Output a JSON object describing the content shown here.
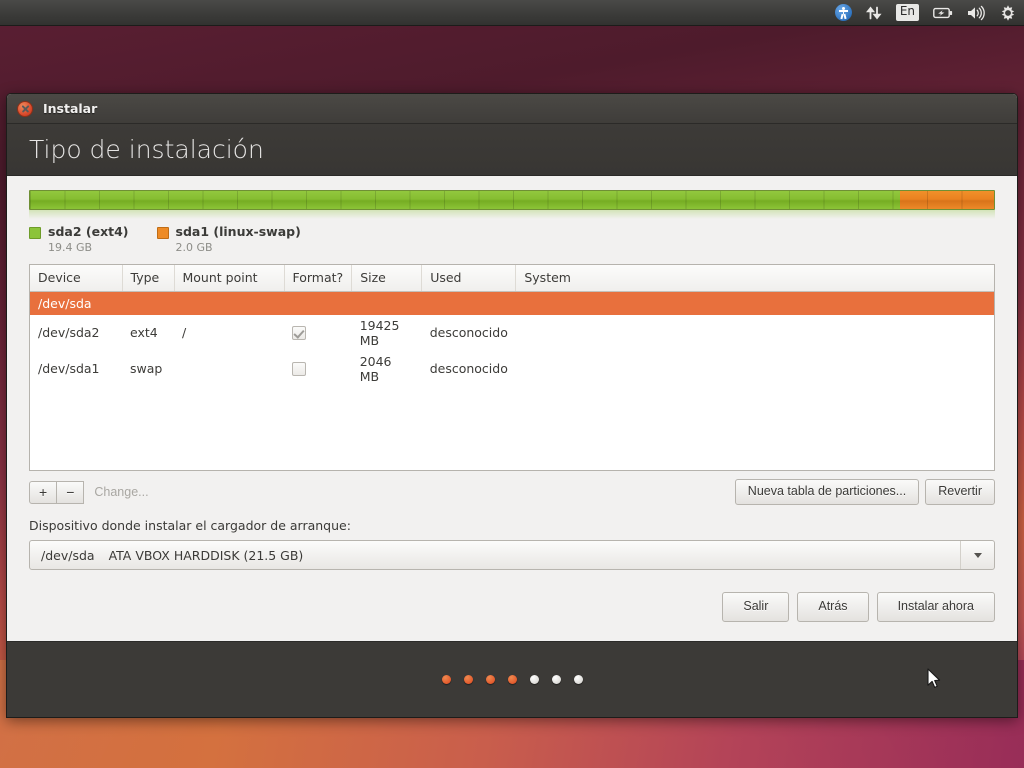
{
  "panel": {
    "icons": [
      {
        "name": "accessibility-icon",
        "label": ""
      },
      {
        "name": "network-icon",
        "label": ""
      },
      {
        "name": "keyboard-layout-indicator",
        "label": "En"
      },
      {
        "name": "battery-icon",
        "label": ""
      },
      {
        "name": "volume-icon",
        "label": ""
      },
      {
        "name": "system-settings-icon",
        "label": ""
      }
    ],
    "keyboard_layout": "En"
  },
  "window": {
    "title": "Instalar",
    "heading": "Tipo de instalación"
  },
  "partition_bar": {
    "segments": [
      {
        "label": "sda2 (ext4)",
        "size": "19.4 GB",
        "color": "#8cc43a",
        "percent": 90.2
      },
      {
        "label": "sda1 (linux-swap)",
        "size": "2.0 GB",
        "color": "#ee8b26",
        "percent": 9.8
      }
    ]
  },
  "table": {
    "columns": [
      "Device",
      "Type",
      "Mount point",
      "Format?",
      "Size",
      "Used",
      "System"
    ],
    "rows": [
      {
        "kind": "disk",
        "selected": true,
        "device": "/dev/sda",
        "type": "",
        "mount_point": "",
        "format": null,
        "size": "",
        "used": "",
        "system": ""
      },
      {
        "kind": "partition",
        "selected": false,
        "device": "/dev/sda2",
        "type": "ext4",
        "mount_point": "/",
        "format": true,
        "size": "19425 MB",
        "used": "desconocido",
        "system": ""
      },
      {
        "kind": "partition",
        "selected": false,
        "device": "/dev/sda1",
        "type": "swap",
        "mount_point": "",
        "format": false,
        "size": "2046 MB",
        "used": "desconocido",
        "system": ""
      }
    ]
  },
  "tools": {
    "add_label": "+",
    "remove_label": "−",
    "change_label": "Change...",
    "new_table_label": "Nueva tabla de particiones...",
    "revert_label": "Revertir"
  },
  "bootloader": {
    "label": "Dispositivo donde instalar el cargador de arranque:",
    "selected_device": "/dev/sda",
    "selected_description": "ATA VBOX HARDDISK (21.5 GB)"
  },
  "actions": {
    "quit_label": "Salir",
    "back_label": "Atrás",
    "install_label": "Instalar ahora"
  },
  "progress_dots": {
    "total": 7,
    "active": 4
  },
  "colors": {
    "selection_orange": "#e8703d",
    "partition_green": "#8cc43a",
    "partition_orange": "#ee8b26",
    "window_chrome": "#3d3b38"
  }
}
